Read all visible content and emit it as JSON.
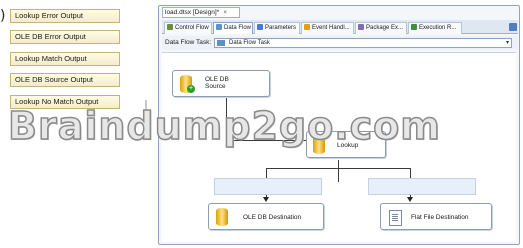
{
  "left_panel": {
    "paren": ")",
    "items": [
      "Lookup Error Output",
      "OLE DB Error Output",
      "Lookup Match Output",
      "OLE DB Source Output",
      "Lookup No Match Output"
    ]
  },
  "document_tab": {
    "label": "load.dtsx [Design]*",
    "close": "×"
  },
  "designer_tabs": [
    "Control Flow",
    "Data Flow",
    "Parameters",
    "Event Handl...",
    "Package Ex...",
    "Execution R..."
  ],
  "active_tab": "Data Flow",
  "task": {
    "label": "Data Flow Task:",
    "value": "Data Flow Task",
    "drop": "▾"
  },
  "components": {
    "source_line1": "OLE DB",
    "source_line2": "Source",
    "lookup": "Lookup",
    "dest_oledb": "OLE DB Destination",
    "dest_flat": "Flat File Destination"
  },
  "watermark": "Braindump2go.com",
  "colors": {
    "accent": "#5e8fd0",
    "cylinder": "#e0b400",
    "add": "#2f9a2f"
  }
}
